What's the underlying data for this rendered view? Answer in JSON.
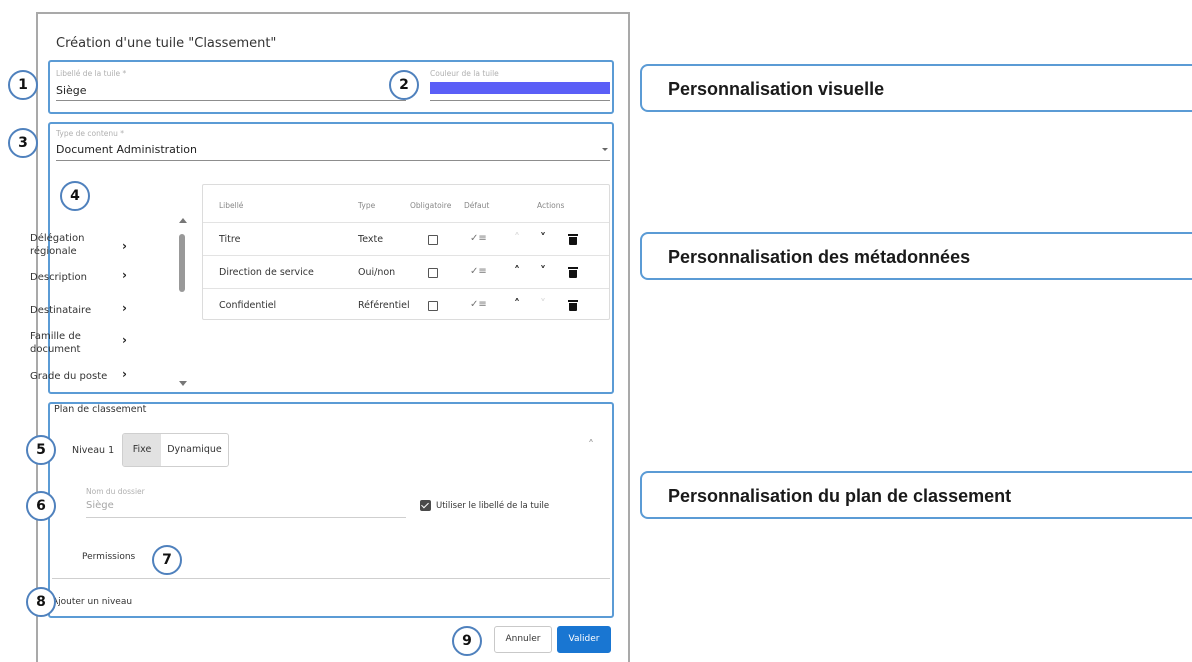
{
  "dialog": {
    "title": "Création d'une tuile \"Classement\""
  },
  "visual": {
    "tile_label_label": "Libellé de la tuile *",
    "tile_label_value": "Siège",
    "tile_color_label": "Couleur de la tuile",
    "tile_color": "#5b5ff7"
  },
  "content": {
    "type_label": "Type de contenu *",
    "type_value": "Document Administration",
    "fields": [
      {
        "label": "Délégation régionale"
      },
      {
        "label": "Description"
      },
      {
        "label": "Destinataire"
      },
      {
        "label": "Famille de document"
      },
      {
        "label": "Grade du poste"
      }
    ],
    "table": {
      "headers": {
        "label": "Libellé",
        "type": "Type",
        "required": "Obligatoire",
        "default": "Défaut",
        "actions": "Actions"
      },
      "rows": [
        {
          "label": "Titre",
          "type": "Texte",
          "required": false,
          "up_enabled": false,
          "down_enabled": true
        },
        {
          "label": "Direction de service",
          "type": "Oui/non",
          "required": false,
          "up_enabled": true,
          "down_enabled": true
        },
        {
          "label": "Confidentiel",
          "type": "Référentiel",
          "required": false,
          "up_enabled": true,
          "down_enabled": false
        }
      ]
    }
  },
  "plan": {
    "title": "Plan de classement",
    "level_label": "Niveau 1",
    "mode_fixed": "Fixe",
    "mode_dynamic": "Dynamique",
    "folder_name_label": "Nom du dossier",
    "folder_name_value": "Siège",
    "use_tile_label": "Utiliser le libellé de la tuile",
    "use_tile_checked": true,
    "permissions_label": "Permissions",
    "add_level": "Ajouter un niveau"
  },
  "buttons": {
    "cancel": "Annuler",
    "validate": "Valider"
  },
  "badges": [
    "1",
    "2",
    "3",
    "4",
    "5",
    "6",
    "7",
    "8",
    "9"
  ],
  "callouts": {
    "visual": "Personnalisation visuelle",
    "metadata": "Personnalisation des métadonnées",
    "plan": "Personnalisation du plan de classement"
  },
  "colors": {
    "accent": "#1976d2",
    "annotation": "#5b9bd5"
  }
}
